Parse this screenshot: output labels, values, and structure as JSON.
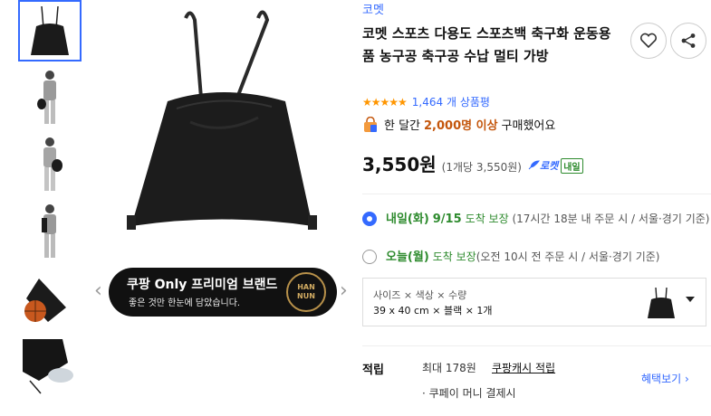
{
  "gallery": {
    "thumbnail_count": 6,
    "banner_title": "쿠팡 Only 프리미엄 브랜드",
    "banner_subtitle": "좋은 것만 한눈에 담았습니다.",
    "banner_badge_top": "HAN",
    "banner_badge_bottom": "NUN",
    "prev_arrow": "‹",
    "next_arrow": "›"
  },
  "product": {
    "brand": "코멧",
    "title": "코멧 스포츠 다용도 스포츠백 축구화 운동용품 농구공 축구공 수납 멀티 가방",
    "rating_stars": "★★★★★",
    "rating_value": 5,
    "review_count": "1,464 개 상품평",
    "purchase_prefix": "한 달간",
    "purchase_count": "2,000명 이상",
    "purchase_suffix": "구매했어요",
    "price": "3,550원",
    "unit_price": "(1개당 3,550원)",
    "rocket_label": "로켓",
    "rocket_badge": "내일"
  },
  "shipping": [
    {
      "day": "내일(화)",
      "date": "9/15",
      "label": "도착 보장",
      "detail": "(17시간 18분 내 주문 시 / 서울·경기 기준)",
      "selected": true
    },
    {
      "day": "오늘(월)",
      "date": "",
      "label": "도착 보장",
      "detail": "(오전 10시 전 주문 시 / 서울·경기 기준)",
      "selected": false
    }
  ],
  "option": {
    "label": "사이즈 × 색상 × 수량",
    "value": "39 x 40 cm × 블랙 × 1개"
  },
  "points": {
    "label": "적립",
    "max": "최대 178원",
    "link": "쿠팡캐시 적립",
    "benefit_link": "혜택보기 ›",
    "pay": "· 쿠페이 머니 결제시"
  },
  "colors": {
    "accent": "#346aff",
    "green": "#2e8b2e",
    "star": "#ff9600",
    "highlight": "#c4560c"
  }
}
